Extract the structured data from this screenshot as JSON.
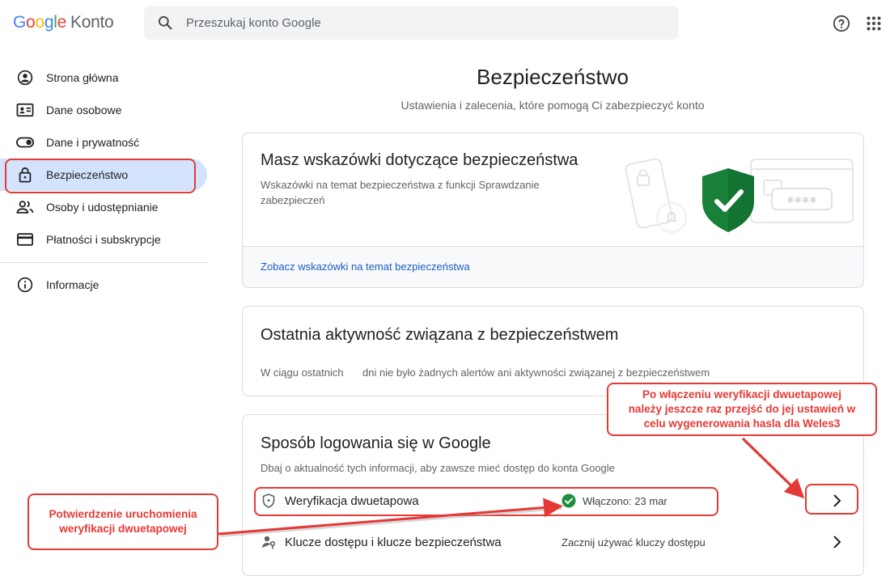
{
  "header": {
    "logo_letters": [
      "G",
      "o",
      "o",
      "g",
      "l",
      "e"
    ],
    "logo_product": "Konto",
    "search_placeholder": "Przeszukaj konto Google"
  },
  "nav": {
    "items": [
      {
        "label": "Strona główna",
        "icon": "account-circle-icon"
      },
      {
        "label": "Dane osobowe",
        "icon": "id-card-icon"
      },
      {
        "label": "Dane i prywatność",
        "icon": "toggle-icon"
      },
      {
        "label": "Bezpieczeństwo",
        "icon": "lock-icon"
      },
      {
        "label": "Osoby i udostępnianie",
        "icon": "people-icon"
      },
      {
        "label": "Płatności i subskrypcje",
        "icon": "credit-card-icon"
      }
    ],
    "info_label": "Informacje"
  },
  "main": {
    "title": "Bezpieczeństwo",
    "subtitle": "Ustawienia i zalecenia, które pomogą Ci zabezpieczyć konto",
    "tips_card": {
      "title": "Masz wskazówki dotyczące bezpieczeństwa",
      "desc_line1": "Wskazówki na temat bezpieczeństwa z funkcji Sprawdzanie",
      "desc_line2": "zabezpieczeń",
      "link": "Zobacz wskazówki na temat bezpieczeństwa",
      "illustration_password": "✱✱✱✱"
    },
    "activity_card": {
      "title": "Ostatnia aktywność związana z bezpieczeństwem",
      "text_a": "W ciągu ostatnich",
      "text_b": "dni nie było żadnych alertów ani aktywności związanej z bezpieczeństwem"
    },
    "signin_card": {
      "title": "Sposób logowania się w Google",
      "desc": "Dbaj o aktualność tych informacji, aby zawsze mieć dostęp do konta Google",
      "rows": [
        {
          "label": "Weryfikacja dwuetapowa",
          "status": "Włączono: 23 mar"
        },
        {
          "label": "Klucze dostępu i klucze bezpieczeństwa",
          "status": "Zacznij używać kluczy dostępu"
        }
      ]
    }
  },
  "annotations": {
    "left_line1": "Potwierdzenie uruchomienia",
    "left_line2": "weryfikacji dwuetapowej",
    "right_line1": "Po włączeniu weryfikacji dwuetapowej",
    "right_line2": "należy jeszcze raz przejść do jej ustawień w",
    "right_line3": "celu wygenerowania hasla dla Weles3"
  },
  "colors": {
    "annotation_red": "#e53935",
    "active_nav_bg": "#d3e3fd",
    "link_blue": "#1a5fc5",
    "success_green": "#1e8e3e"
  }
}
